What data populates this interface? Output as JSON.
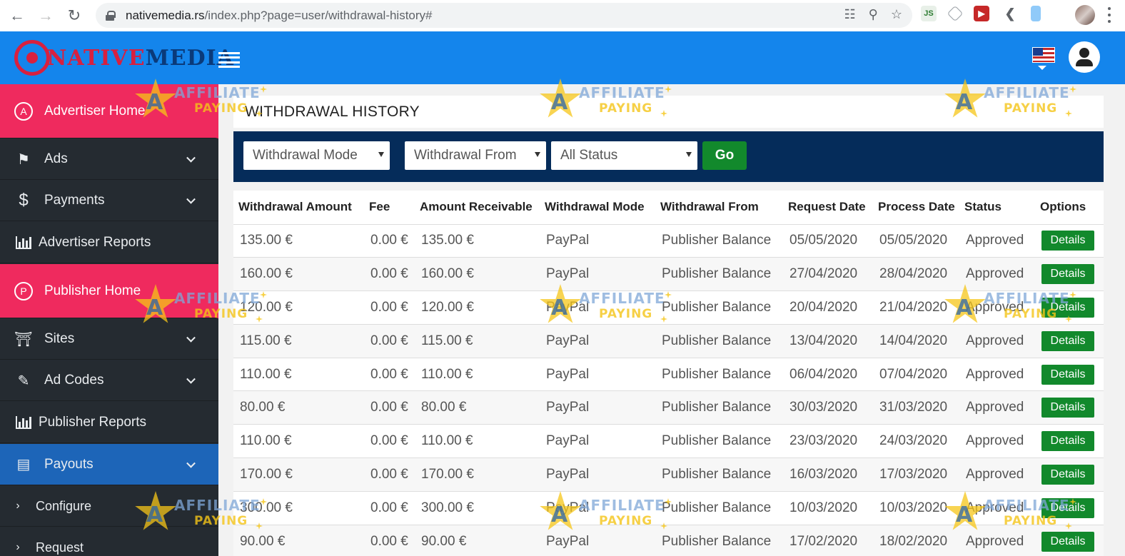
{
  "browser": {
    "url_host": "nativemedia.rs",
    "url_path": "/index.php?page=user/withdrawal-history#",
    "ext_js_label": "JS"
  },
  "header": {
    "logo_part1": "NATIVE",
    "logo_part2": "MEDIA",
    "accent_color": "#1485ec",
    "brand_red": "#ef2a5e"
  },
  "sidebar": {
    "advertiser_home": "Advertiser Home",
    "advertiser_home_badge": "A",
    "ads": "Ads",
    "payments": "Payments",
    "payments_icon": "$",
    "advertiser_reports": "Advertiser Reports",
    "publisher_home": "Publisher Home",
    "publisher_home_badge": "P",
    "sites": "Sites",
    "ad_codes": "Ad Codes",
    "publisher_reports": "Publisher Reports",
    "payouts": "Payouts",
    "configure": "Configure",
    "request": "Request"
  },
  "page": {
    "title": "WITHDRAWAL HISTORY"
  },
  "filters": {
    "mode": "Withdrawal Mode",
    "from": "Withdrawal From",
    "status": "All Status",
    "go": "Go"
  },
  "table": {
    "headers": [
      "Withdrawal Amount",
      "Fee",
      "Amount Receivable",
      "Withdrawal Mode",
      "Withdrawal From",
      "Request Date",
      "Process Date",
      "Status",
      "Options"
    ],
    "details_label": "Details",
    "rows": [
      [
        "135.00 €",
        "0.00 €",
        "135.00 €",
        "PayPal",
        "Publisher Balance",
        "05/05/2020",
        "05/05/2020",
        "Approved"
      ],
      [
        "160.00 €",
        "0.00 €",
        "160.00 €",
        "PayPal",
        "Publisher Balance",
        "27/04/2020",
        "28/04/2020",
        "Approved"
      ],
      [
        "120.00 €",
        "0.00 €",
        "120.00 €",
        "PayPal",
        "Publisher Balance",
        "20/04/2020",
        "21/04/2020",
        "Approved"
      ],
      [
        "115.00 €",
        "0.00 €",
        "115.00 €",
        "PayPal",
        "Publisher Balance",
        "13/04/2020",
        "14/04/2020",
        "Approved"
      ],
      [
        "110.00 €",
        "0.00 €",
        "110.00 €",
        "PayPal",
        "Publisher Balance",
        "06/04/2020",
        "07/04/2020",
        "Approved"
      ],
      [
        "80.00 €",
        "0.00 €",
        "80.00 €",
        "PayPal",
        "Publisher Balance",
        "30/03/2020",
        "31/03/2020",
        "Approved"
      ],
      [
        "110.00 €",
        "0.00 €",
        "110.00 €",
        "PayPal",
        "Publisher Balance",
        "23/03/2020",
        "24/03/2020",
        "Approved"
      ],
      [
        "170.00 €",
        "0.00 €",
        "170.00 €",
        "PayPal",
        "Publisher Balance",
        "16/03/2020",
        "17/03/2020",
        "Approved"
      ],
      [
        "300.00 €",
        "0.00 €",
        "300.00 €",
        "PayPal",
        "Publisher Balance",
        "10/03/2020",
        "10/03/2020",
        "Approved"
      ],
      [
        "90.00 €",
        "0.00 €",
        "90.00 €",
        "PayPal",
        "Publisher Balance",
        "17/02/2020",
        "18/02/2020",
        "Approved"
      ]
    ]
  },
  "watermark": {
    "line1": "AFFILIATE",
    "line2": "PAYING",
    "star_letter": "A"
  }
}
